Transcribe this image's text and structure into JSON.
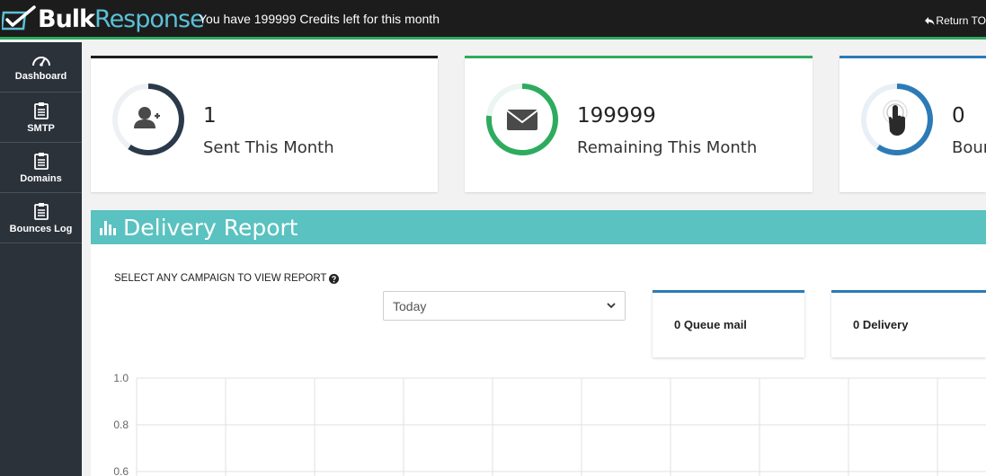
{
  "header": {
    "logo_bulk": "Bulk",
    "logo_response": "Response",
    "credits_text": "You have 199999 Credits left for this month",
    "return_label": "Return TO"
  },
  "sidebar": {
    "items": [
      {
        "label": "Dashboard",
        "icon": "gauge-icon"
      },
      {
        "label": "SMTP",
        "icon": "clipboard-icon"
      },
      {
        "label": "Domains",
        "icon": "clipboard-icon"
      },
      {
        "label": "Bounces Log",
        "icon": "clipboard-icon"
      }
    ]
  },
  "stats": [
    {
      "value": "1",
      "label": "Sent This Month",
      "icon": "add-user-icon",
      "color": "#2b3a4a"
    },
    {
      "value": "199999",
      "label": "Remaining This Month",
      "icon": "envelope-icon",
      "color": "#2eab5f"
    },
    {
      "value": "0",
      "label": "Bounced This Month",
      "icon": "pointer-hand-icon",
      "color": "#2c7bb6"
    }
  ],
  "report": {
    "title": "Delivery Report",
    "select_label": "SELECT ANY CAMPAIGN TO VIEW REPORT",
    "select_value": "Today",
    "queue": "0 Queue mail",
    "delivery": "0 Delivery"
  },
  "chart_data": {
    "type": "line",
    "yticks": [
      "1.0",
      "0.8",
      "0.6"
    ],
    "ylim": [
      0,
      1.0
    ],
    "grid": true
  },
  "colors": {
    "accent_green": "#2eab5f",
    "accent_blue": "#2c7bb6",
    "header_teal": "#5ac2c0",
    "sidebar": "#2b323a"
  }
}
